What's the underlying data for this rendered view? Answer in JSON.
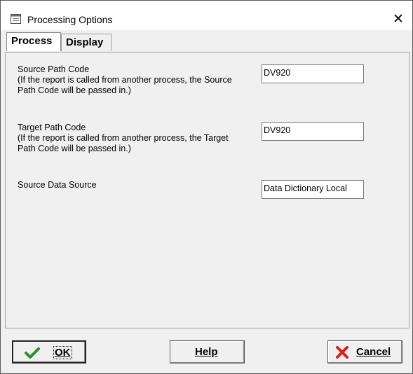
{
  "window": {
    "title": "Processing Options",
    "close_symbol": "✕"
  },
  "tabs": [
    {
      "label": "Process",
      "active": true
    },
    {
      "label": "Display",
      "active": false
    }
  ],
  "options": [
    {
      "label": "Source Path Code",
      "description": "(If the report is called from another process, the Source\nPath Code will be passed in.)",
      "value": "DV920"
    },
    {
      "label": "Target Path Code",
      "description": "(If the report is called from another process, the Target\nPath Code will be passed in.)",
      "value": "DV920"
    },
    {
      "label": "Source Data Source",
      "description": "",
      "value": "Data Dictionary Local"
    }
  ],
  "buttons": {
    "ok": {
      "label": "OK",
      "icon": "checkmark-icon",
      "icon_color": "#2e8b2e"
    },
    "help": {
      "label": "Help"
    },
    "cancel": {
      "label": "Cancel",
      "icon": "x-icon",
      "icon_color": "#d42020"
    }
  }
}
